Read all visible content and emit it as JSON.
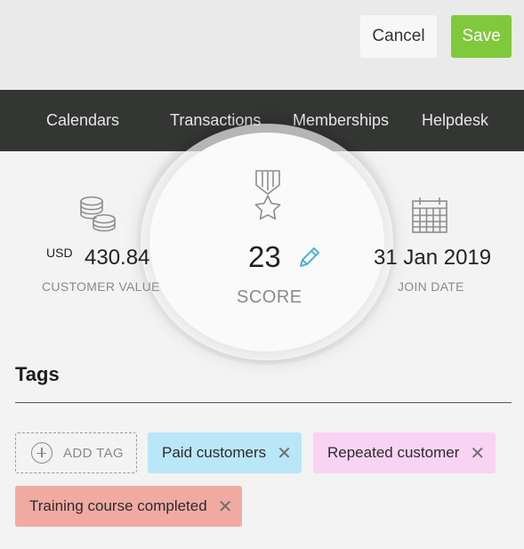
{
  "toolbar": {
    "cancel_label": "Cancel",
    "save_label": "Save",
    "save_color": "#80c93c"
  },
  "nav": {
    "items": [
      {
        "label": "Calendars"
      },
      {
        "label": "Transactions"
      },
      {
        "label": "Memberships"
      },
      {
        "label": "Helpdesk"
      }
    ]
  },
  "stats": {
    "customer_value": {
      "currency": "USD",
      "value": "430.84",
      "label": "CUSTOMER VALUE",
      "icon": "coins-icon"
    },
    "score": {
      "value": "23",
      "label": "SCORE",
      "icon": "medal-icon",
      "edit_icon": "pencil-icon"
    },
    "join_date": {
      "value": "31 Jan 2019",
      "label": "JOIN DATE",
      "icon": "calendar-icon"
    }
  },
  "tags": {
    "title": "Tags",
    "add_label": "ADD TAG",
    "items": [
      {
        "label": "Paid customers",
        "color": "#b9e7f8"
      },
      {
        "label": "Repeated customer",
        "color": "#f8d3f3"
      },
      {
        "label": "Training course completed",
        "color": "#f0aaa1"
      }
    ]
  }
}
